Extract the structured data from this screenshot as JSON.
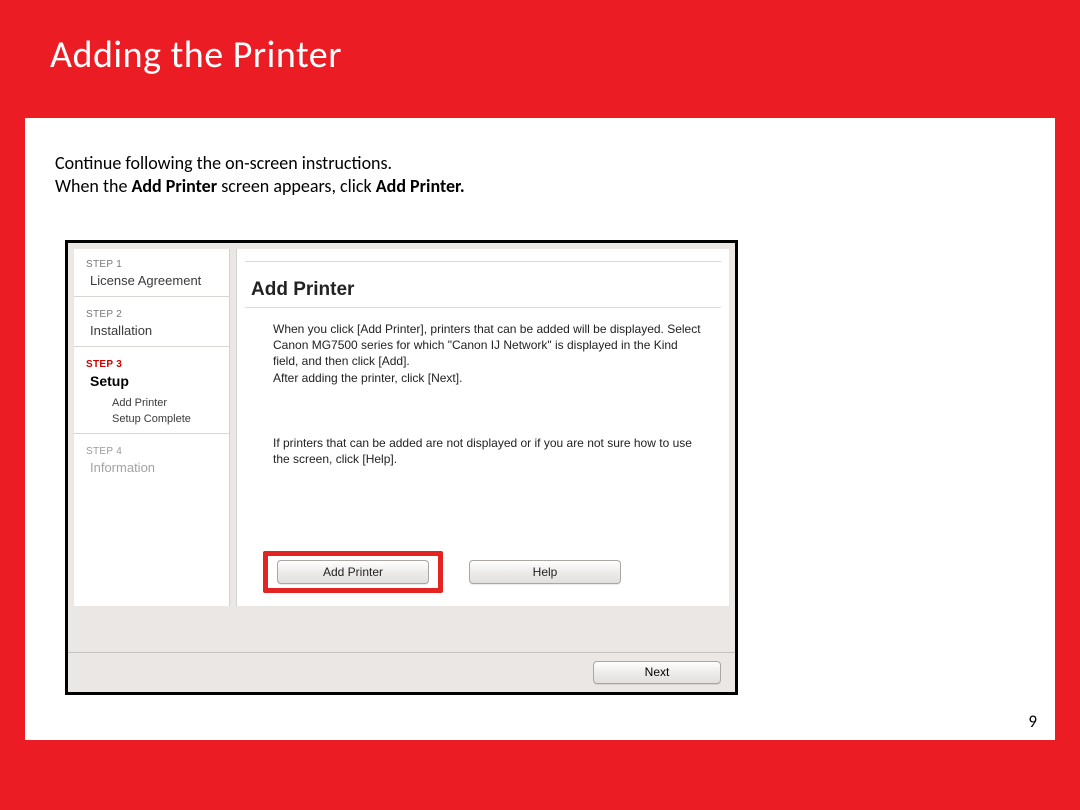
{
  "page": {
    "title": "Adding  the Printer",
    "number": "9",
    "intro_line1": "Continue following the on-screen instructions.",
    "intro_prefix": "When the ",
    "intro_bold1": "Add Printer",
    "intro_mid": " screen appears, click ",
    "intro_bold2": "Add Printer."
  },
  "sidebar": {
    "step1_label": "STEP 1",
    "step1_item": "License Agreement",
    "step2_label": "STEP 2",
    "step2_item": "Installation",
    "step3_label": "STEP 3",
    "step3_item": "Setup",
    "step3_sub1": "Add Printer",
    "step3_sub2": "Setup Complete",
    "step4_label": "STEP 4",
    "step4_item": "Information"
  },
  "pane": {
    "title": "Add Printer",
    "para1": "When you click [Add Printer], printers that can be added will be displayed. Select Canon MG7500 series for which \"Canon IJ Network\" is displayed in the Kind field, and then click [Add].\nAfter adding the printer, click [Next].",
    "para2": "If printers that can be added are not displayed or if you are not sure how to use the screen, click [Help].",
    "add_btn": "Add Printer",
    "help_btn": "Help",
    "next_btn": "Next"
  }
}
